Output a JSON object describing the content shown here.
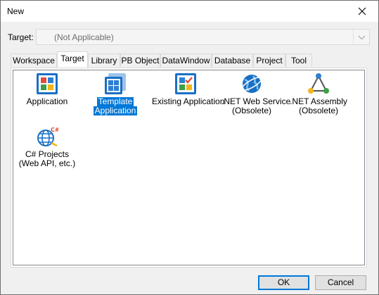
{
  "window": {
    "title": "New"
  },
  "target": {
    "label": "Target:",
    "value": "(Not Applicable)"
  },
  "tabs": [
    {
      "label": "Workspace",
      "active": false
    },
    {
      "label": "Target",
      "active": true
    },
    {
      "label": "Library",
      "active": false
    },
    {
      "label": "PB Object",
      "active": false
    },
    {
      "label": "DataWindow",
      "active": false
    },
    {
      "label": "Database",
      "active": false
    },
    {
      "label": "Project",
      "active": false
    },
    {
      "label": "Tool",
      "active": false
    }
  ],
  "items": [
    {
      "line1": "Application",
      "line2": "",
      "icon": "application-icon",
      "selected": false
    },
    {
      "line1": "Template",
      "line2": "Application",
      "icon": "template-application-icon",
      "selected": true
    },
    {
      "line1": "Existing Application",
      "line2": "",
      "icon": "existing-application-icon",
      "selected": false
    },
    {
      "line1": ".NET Web Service",
      "line2": "(Obsolete)",
      "icon": "globe-web-service-icon",
      "selected": false
    },
    {
      "line1": ".NET Assembly",
      "line2": "(Obsolete)",
      "icon": "assembly-triangle-icon",
      "selected": false
    },
    {
      "line1": "C# Projects",
      "line2": "(Web API, etc.)",
      "icon": "csharp-globe-icon",
      "selected": false
    }
  ],
  "buttons": {
    "ok": "OK",
    "cancel": "Cancel"
  },
  "colors": {
    "accent": "#0078d7",
    "selection": "#0078d7"
  }
}
